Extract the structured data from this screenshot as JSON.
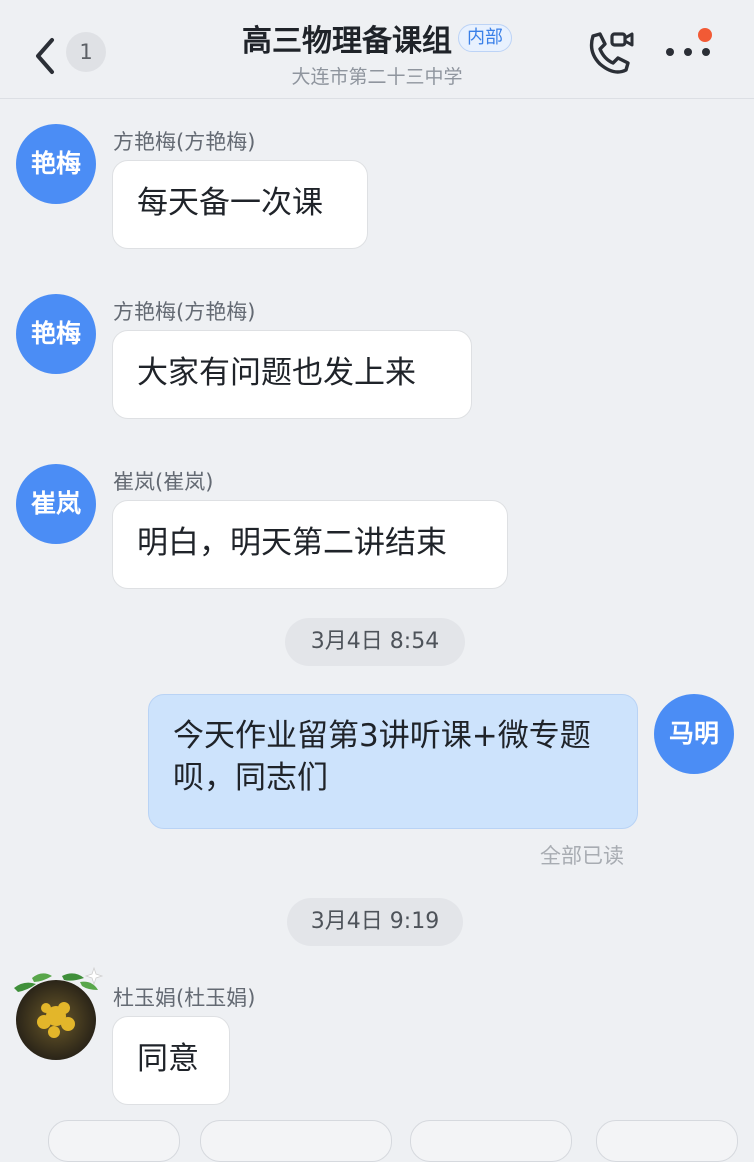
{
  "header": {
    "back_badge": "1",
    "title": "高三物理备课组",
    "tag": "内部",
    "subtitle": "大连市第二十三中学"
  },
  "messages": [
    {
      "avatar": "艳梅",
      "sender": "方艳梅(方艳梅)",
      "text": "每天备一次课"
    },
    {
      "avatar": "艳梅",
      "sender": "方艳梅(方艳梅)",
      "text": "大家有问题也发上来"
    },
    {
      "avatar": "崔岚",
      "sender": "崔岚(崔岚)",
      "text": "明白，明天第二讲结束"
    }
  ],
  "time1": "3月4日 8:54",
  "self_message": {
    "avatar": "马明",
    "text": "今天作业留第3讲听课+微专题呗，同志们",
    "status": "全部已读"
  },
  "time2": "3月4日 9:19",
  "last_message": {
    "sender": "杜玉娟(杜玉娟)",
    "text": "同意"
  },
  "colors": {
    "background": "#eef0f3",
    "avatar_blue": "#4b8df5",
    "self_bubble": "#cde3fc",
    "tag_blue": "#3a80e8",
    "notification_dot": "#f25a35"
  }
}
